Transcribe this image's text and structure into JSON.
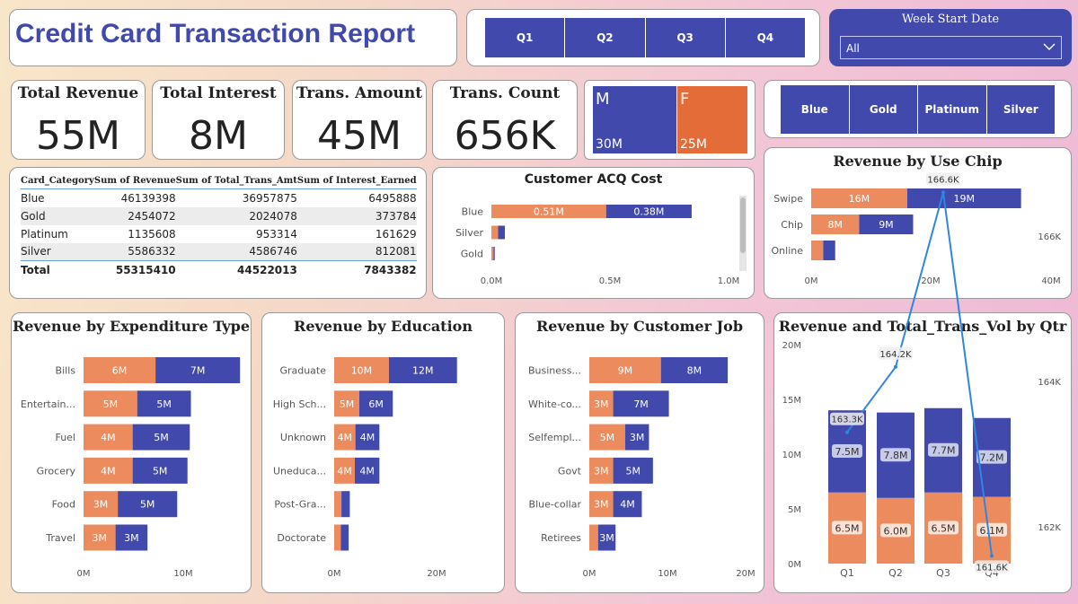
{
  "header": {
    "title": "Credit Card Transaction Report"
  },
  "quarter_slicer": {
    "options": [
      "Q1",
      "Q2",
      "Q3",
      "Q4"
    ]
  },
  "week_filter": {
    "label": "Week Start Date",
    "selected": "All"
  },
  "kpis": [
    {
      "label": "Total Revenue",
      "value": "55M"
    },
    {
      "label": "Total Interest",
      "value": "8M"
    },
    {
      "label": "Trans. Amount",
      "value": "45M"
    },
    {
      "label": "Trans. Count",
      "value": "656K"
    }
  ],
  "gender": {
    "male": {
      "label": "M",
      "value": "30M"
    },
    "female": {
      "label": "F",
      "value": "25M"
    }
  },
  "card_slicer": {
    "options": [
      "Blue",
      "Gold",
      "Platinum",
      "Silver"
    ]
  },
  "category_table": {
    "headers": [
      "Card_Category",
      "Sum of Revenue",
      "Sum of Total_Trans_Amt",
      "Sum of Interest_Earned"
    ],
    "rows": [
      [
        "Blue",
        "46139398",
        "36957875",
        "6495888"
      ],
      [
        "Gold",
        "2454072",
        "2024078",
        "373784"
      ],
      [
        "Platinum",
        "1135608",
        "953314",
        "161629"
      ],
      [
        "Silver",
        "5586332",
        "4586746",
        "812081"
      ]
    ],
    "total": [
      "Total",
      "55315410",
      "44522013",
      "7843382"
    ]
  },
  "colors": {
    "female": "#ec8c5e",
    "male": "#4149ad",
    "gender_f_card": "#e36c38",
    "line": "#2f86e0"
  },
  "chart_data": [
    {
      "id": "acq",
      "type": "bar",
      "orientation": "horizontal",
      "stacked": true,
      "title": "Customer ACQ Cost",
      "categories": [
        "Blue",
        "Silver",
        "Gold"
      ],
      "series": [
        {
          "color": "#ec8c5e",
          "values": [
            0.51,
            0.03,
            0.01
          ],
          "labels": [
            "0.51M",
            "",
            ""
          ]
        },
        {
          "color": "#4149ad",
          "values": [
            0.38,
            0.03,
            0.005
          ],
          "labels": [
            "0.38M",
            "",
            ""
          ]
        }
      ],
      "xticks": [
        "0.0M",
        "0.5M",
        "1.0M"
      ],
      "xlim": [
        0,
        1.05
      ]
    },
    {
      "id": "chip",
      "type": "bar",
      "orientation": "horizontal",
      "stacked": true,
      "title": "Revenue by Use Chip",
      "categories": [
        "Swipe",
        "Chip",
        "Online"
      ],
      "series": [
        {
          "color": "#ec8c5e",
          "values": [
            16,
            8,
            2
          ],
          "labels": [
            "16M",
            "8M",
            ""
          ]
        },
        {
          "color": "#4149ad",
          "values": [
            19,
            9,
            2
          ],
          "labels": [
            "19M",
            "9M",
            ""
          ]
        }
      ],
      "xticks": [
        "0M",
        "20M",
        "40M"
      ],
      "xlim": [
        0,
        40
      ]
    },
    {
      "id": "exp",
      "type": "bar",
      "orientation": "horizontal",
      "stacked": true,
      "title": "Revenue by Expenditure Type",
      "categories": [
        "Bills",
        "Entertain...",
        "Fuel",
        "Grocery",
        "Food",
        "Travel"
      ],
      "series": [
        {
          "color": "#ec8c5e",
          "values": [
            6.3,
            4.7,
            4.3,
            4.3,
            3.0,
            2.8
          ],
          "labels": [
            "6M",
            "5M",
            "4M",
            "4M",
            "3M",
            "3M"
          ]
        },
        {
          "color": "#4149ad",
          "values": [
            7.4,
            4.7,
            5.0,
            4.8,
            5.2,
            2.8
          ],
          "labels": [
            "7M",
            "5M",
            "5M",
            "5M",
            "5M",
            "3M"
          ]
        }
      ],
      "xticks": [
        "0M",
        "10M"
      ],
      "xlim": [
        0,
        14
      ]
    },
    {
      "id": "edu",
      "type": "bar",
      "orientation": "horizontal",
      "stacked": true,
      "title": "Revenue by Education",
      "categories": [
        "Graduate",
        "High Sch...",
        "Unknown",
        "Uneduca...",
        "Post-Gra...",
        "Doctorate"
      ],
      "series": [
        {
          "color": "#ec8c5e",
          "values": [
            9.8,
            4.5,
            3.8,
            3.7,
            1.3,
            1.2
          ],
          "labels": [
            "10M",
            "5M",
            "4M",
            "4M",
            "",
            ""
          ]
        },
        {
          "color": "#4149ad",
          "values": [
            12.2,
            6.0,
            4.3,
            4.4,
            1.5,
            1.4
          ],
          "labels": [
            "12M",
            "6M",
            "4M",
            "4M",
            "",
            ""
          ]
        }
      ],
      "xticks": [
        "0M",
        "20M"
      ],
      "xlim": [
        0,
        28
      ]
    },
    {
      "id": "job",
      "type": "bar",
      "orientation": "horizontal",
      "stacked": true,
      "title": "Revenue by Customer Job",
      "categories": [
        "Business...",
        "White-co...",
        "Selfempl...",
        "Govt",
        "Blue-collar",
        "Retirees"
      ],
      "series": [
        {
          "color": "#ec8c5e",
          "values": [
            9.0,
            3.0,
            4.5,
            3.0,
            3.0,
            1.1
          ],
          "labels": [
            "9M",
            "3M",
            "5M",
            "3M",
            "3M",
            ""
          ]
        },
        {
          "color": "#4149ad",
          "values": [
            8.4,
            7.0,
            3.0,
            5.0,
            3.6,
            2.2
          ],
          "labels": [
            "8M",
            "7M",
            "3M",
            "5M",
            "4M",
            "3M"
          ]
        }
      ],
      "xticks": [
        "0M",
        "10M",
        "20M"
      ],
      "xlim": [
        0,
        21
      ]
    },
    {
      "id": "qtr",
      "type": "bar",
      "stacked": true,
      "title": "Revenue and Total_Trans_Vol by Qtr",
      "categories": [
        "Q1",
        "Q2",
        "Q3",
        "Q4"
      ],
      "series": [
        {
          "color": "#ec8c5e",
          "values": [
            6.5,
            6.0,
            6.5,
            6.1
          ],
          "labels": [
            "6.5M",
            "6.0M",
            "6.5M",
            "6.1M"
          ]
        },
        {
          "color": "#4149ad",
          "values": [
            7.5,
            7.8,
            7.7,
            7.2
          ],
          "labels": [
            "7.5M",
            "7.8M",
            "7.7M",
            "7.2M"
          ]
        }
      ],
      "line": {
        "values": [
          163.3,
          164.2,
          166.6,
          161.6
        ],
        "labels": [
          "163.3K",
          "164.2K",
          "166.6K",
          "161.6K"
        ]
      },
      "yticks": [
        "0M",
        "5M",
        "10M",
        "15M",
        "20M"
      ],
      "ylim": [
        0,
        20
      ],
      "y2ticks": [
        "162K",
        "164K",
        "166K"
      ],
      "y2lim": [
        161,
        167
      ]
    }
  ]
}
